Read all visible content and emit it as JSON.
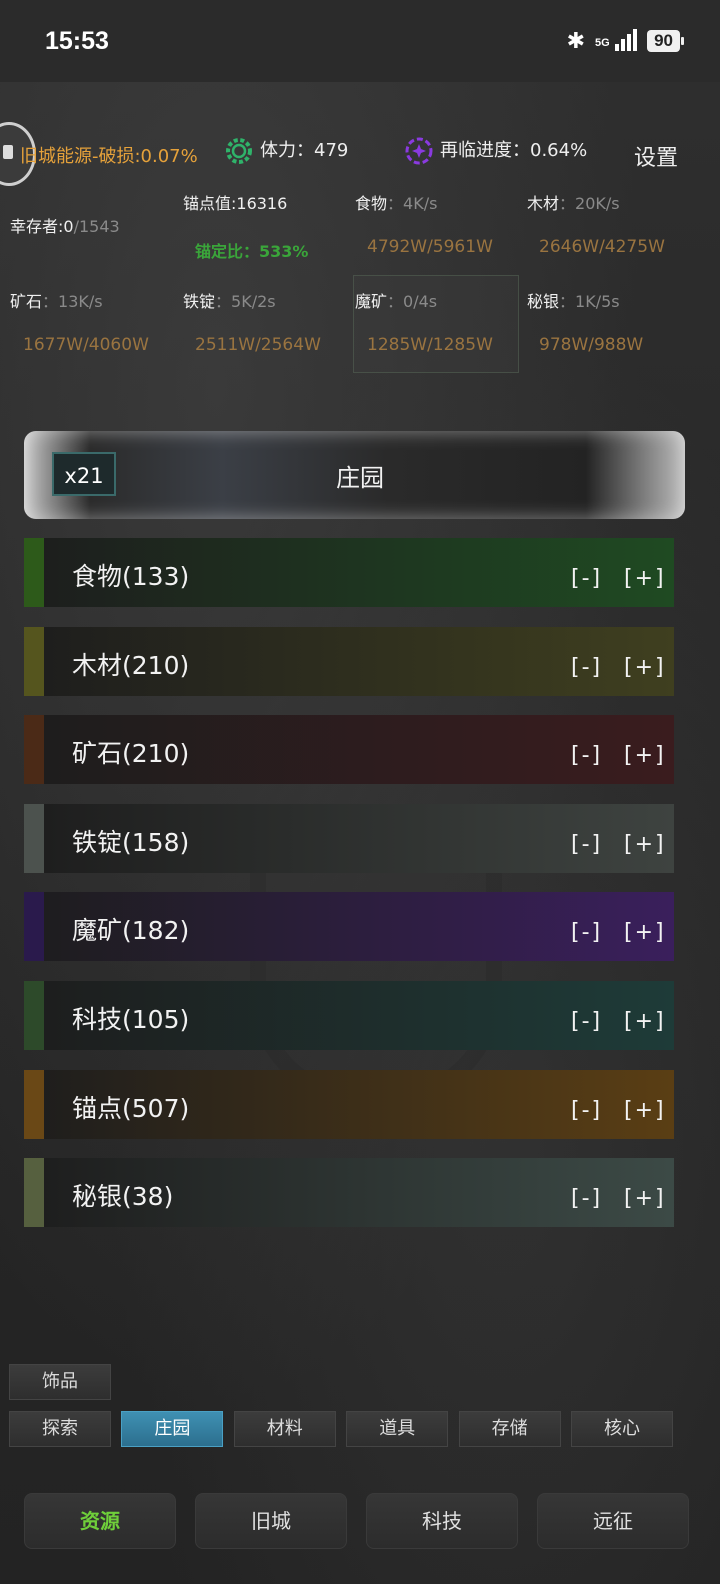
{
  "status_bar": {
    "time": "15:53",
    "network": "5G",
    "battery": "90"
  },
  "top": {
    "city_energy": "旧城能源-破损:0.07%",
    "stamina_label": "体力：",
    "stamina_value": "479",
    "revisit_label": "再临进度：",
    "revisit_value": "0.64%",
    "settings": "设置"
  },
  "stats": {
    "survivors_label": "幸存者:",
    "survivors_cur": "0",
    "survivors_max": "/1543",
    "anchor_value": "锚点值:16316",
    "anchor_ratio_label": "锚定比：",
    "anchor_ratio_value": "533%",
    "resources": [
      {
        "label": "食物",
        "rate": "：4K/s",
        "amount": "4792W/5961W"
      },
      {
        "label": "木材",
        "rate": "：20K/s",
        "amount": "2646W/4275W"
      },
      {
        "label": "矿石",
        "rate": "：13K/s",
        "amount": "1677W/4060W"
      },
      {
        "label": "铁锭",
        "rate": "：5K/2s",
        "amount": "2511W/2564W"
      },
      {
        "label": "魔矿",
        "rate": "：0/4s",
        "amount": "1285W/1285W"
      },
      {
        "label": "秘银",
        "rate": "：1K/5s",
        "amount": "978W/988W"
      }
    ]
  },
  "banner": {
    "badge": "x21",
    "title": "庄园"
  },
  "rows": [
    {
      "label": "食物(133)",
      "minus": "[-]",
      "plus": "[+]",
      "color": "#1f4a22",
      "accent": "#2d5a1a"
    },
    {
      "label": "木材(210)",
      "minus": "[-]",
      "plus": "[+]",
      "color": "#3f3f1f",
      "accent": "#55551e"
    },
    {
      "label": "矿石(210)",
      "minus": "[-]",
      "plus": "[+]",
      "color": "#3a1c1e",
      "accent": "#4b2a17"
    },
    {
      "label": "铁锭(158)",
      "minus": "[-]",
      "plus": "[+]",
      "color": "#3e4340",
      "accent": "#4c524e"
    },
    {
      "label": "魔矿(182)",
      "minus": "[-]",
      "plus": "[+]",
      "color": "#3a1f5c",
      "accent": "#2a1a4c"
    },
    {
      "label": "科技(105)",
      "minus": "[-]",
      "plus": "[+]",
      "color": "#1e3b38",
      "accent": "#2d4a2a"
    },
    {
      "label": "锚点(507)",
      "minus": "[-]",
      "plus": "[+]",
      "color": "#5a3e14",
      "accent": "#6a4816"
    },
    {
      "label": "秘银(38)",
      "minus": "[-]",
      "plus": "[+]",
      "color": "#3c4a46",
      "accent": "#56603f"
    }
  ],
  "tabs": {
    "extra": "饰品",
    "items": [
      "探索",
      "庄园",
      "材料",
      "道具",
      "存储",
      "核心"
    ],
    "active": "庄园"
  },
  "nav": {
    "items": [
      "资源",
      "旧城",
      "科技",
      "远征"
    ],
    "active": "资源"
  }
}
